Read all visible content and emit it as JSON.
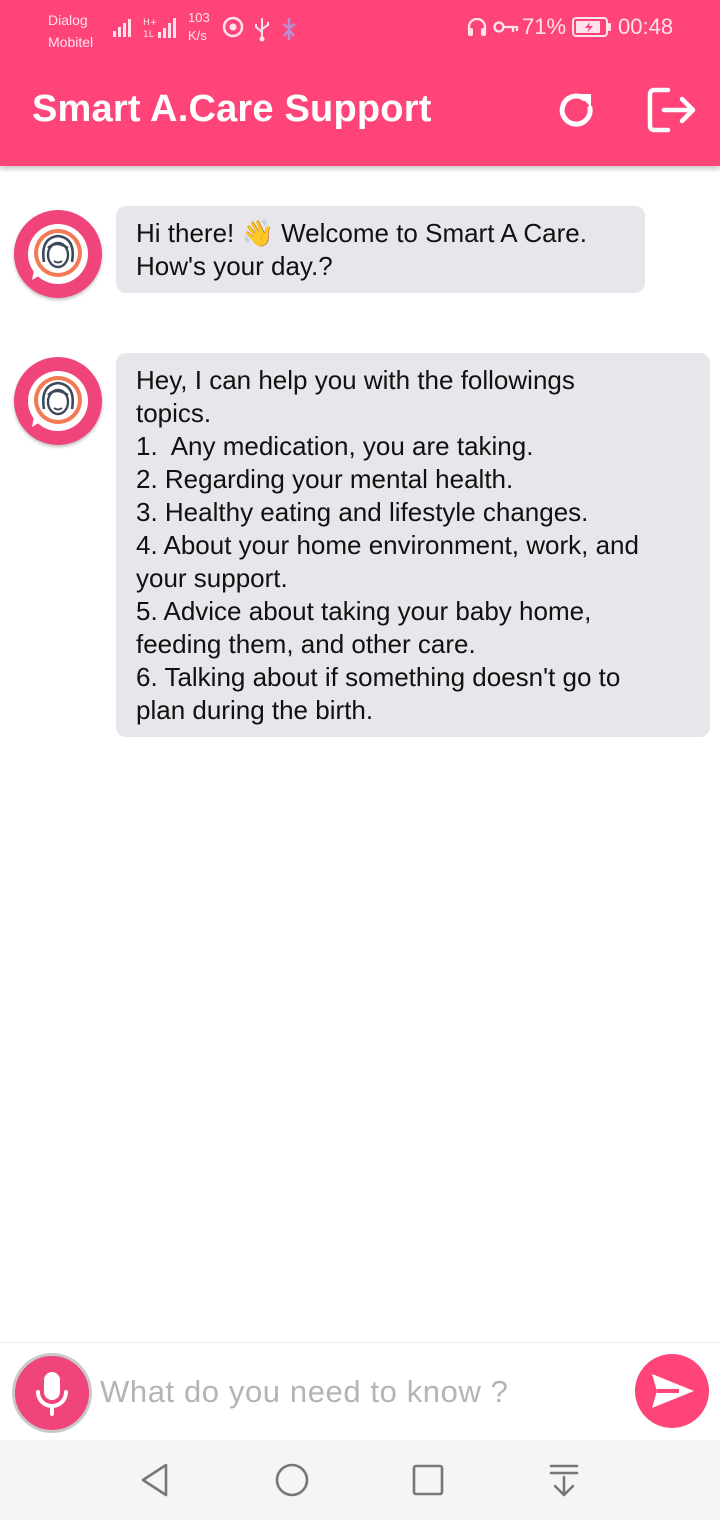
{
  "status_bar": {
    "carrier_line1": "Dialog",
    "carrier_line2": "Mobitel",
    "net_speed_value": "103",
    "net_speed_unit": "K/s",
    "battery_percent": "71%",
    "time": "00:48",
    "icons": [
      "signal-icon",
      "signal-hplus-icon",
      "music-icon",
      "usb-icon",
      "accessibility-icon",
      "headset-icon",
      "key-icon",
      "battery-charging-icon"
    ]
  },
  "app_bar": {
    "title": "Smart A.Care Support",
    "actions": [
      "refresh-icon",
      "logout-icon"
    ],
    "background": "#fe4479"
  },
  "chat": {
    "messages": [
      {
        "sender": "bot",
        "avatar": "female-support-avatar-icon",
        "lines": [
          "Hi there! 👋 Welcome to Smart A Care.",
          "How's your day.?"
        ]
      },
      {
        "sender": "bot",
        "avatar": "female-support-avatar-icon",
        "lines": [
          "Hey, I can help you with the followings",
          "topics.",
          "1.  Any medication, you are taking.",
          "2. Regarding your mental health.",
          "3. Healthy eating and lifestyle changes.",
          "4. About your home environment, work, and",
          "your support.",
          "5. Advice about taking your baby home,",
          "feeding them, and other care.",
          "6. Talking about if something doesn't go to",
          "plan during the birth."
        ]
      }
    ],
    "bubble_color": "#e6e6eb"
  },
  "composer": {
    "mic_icon": "microphone-icon",
    "input_value": "",
    "input_placeholder": "What do you need to know ?",
    "send_icon": "send-icon"
  },
  "nav_bar": {
    "buttons": [
      "back-icon",
      "home-icon",
      "recents-icon",
      "notification-pulldown-icon"
    ]
  }
}
